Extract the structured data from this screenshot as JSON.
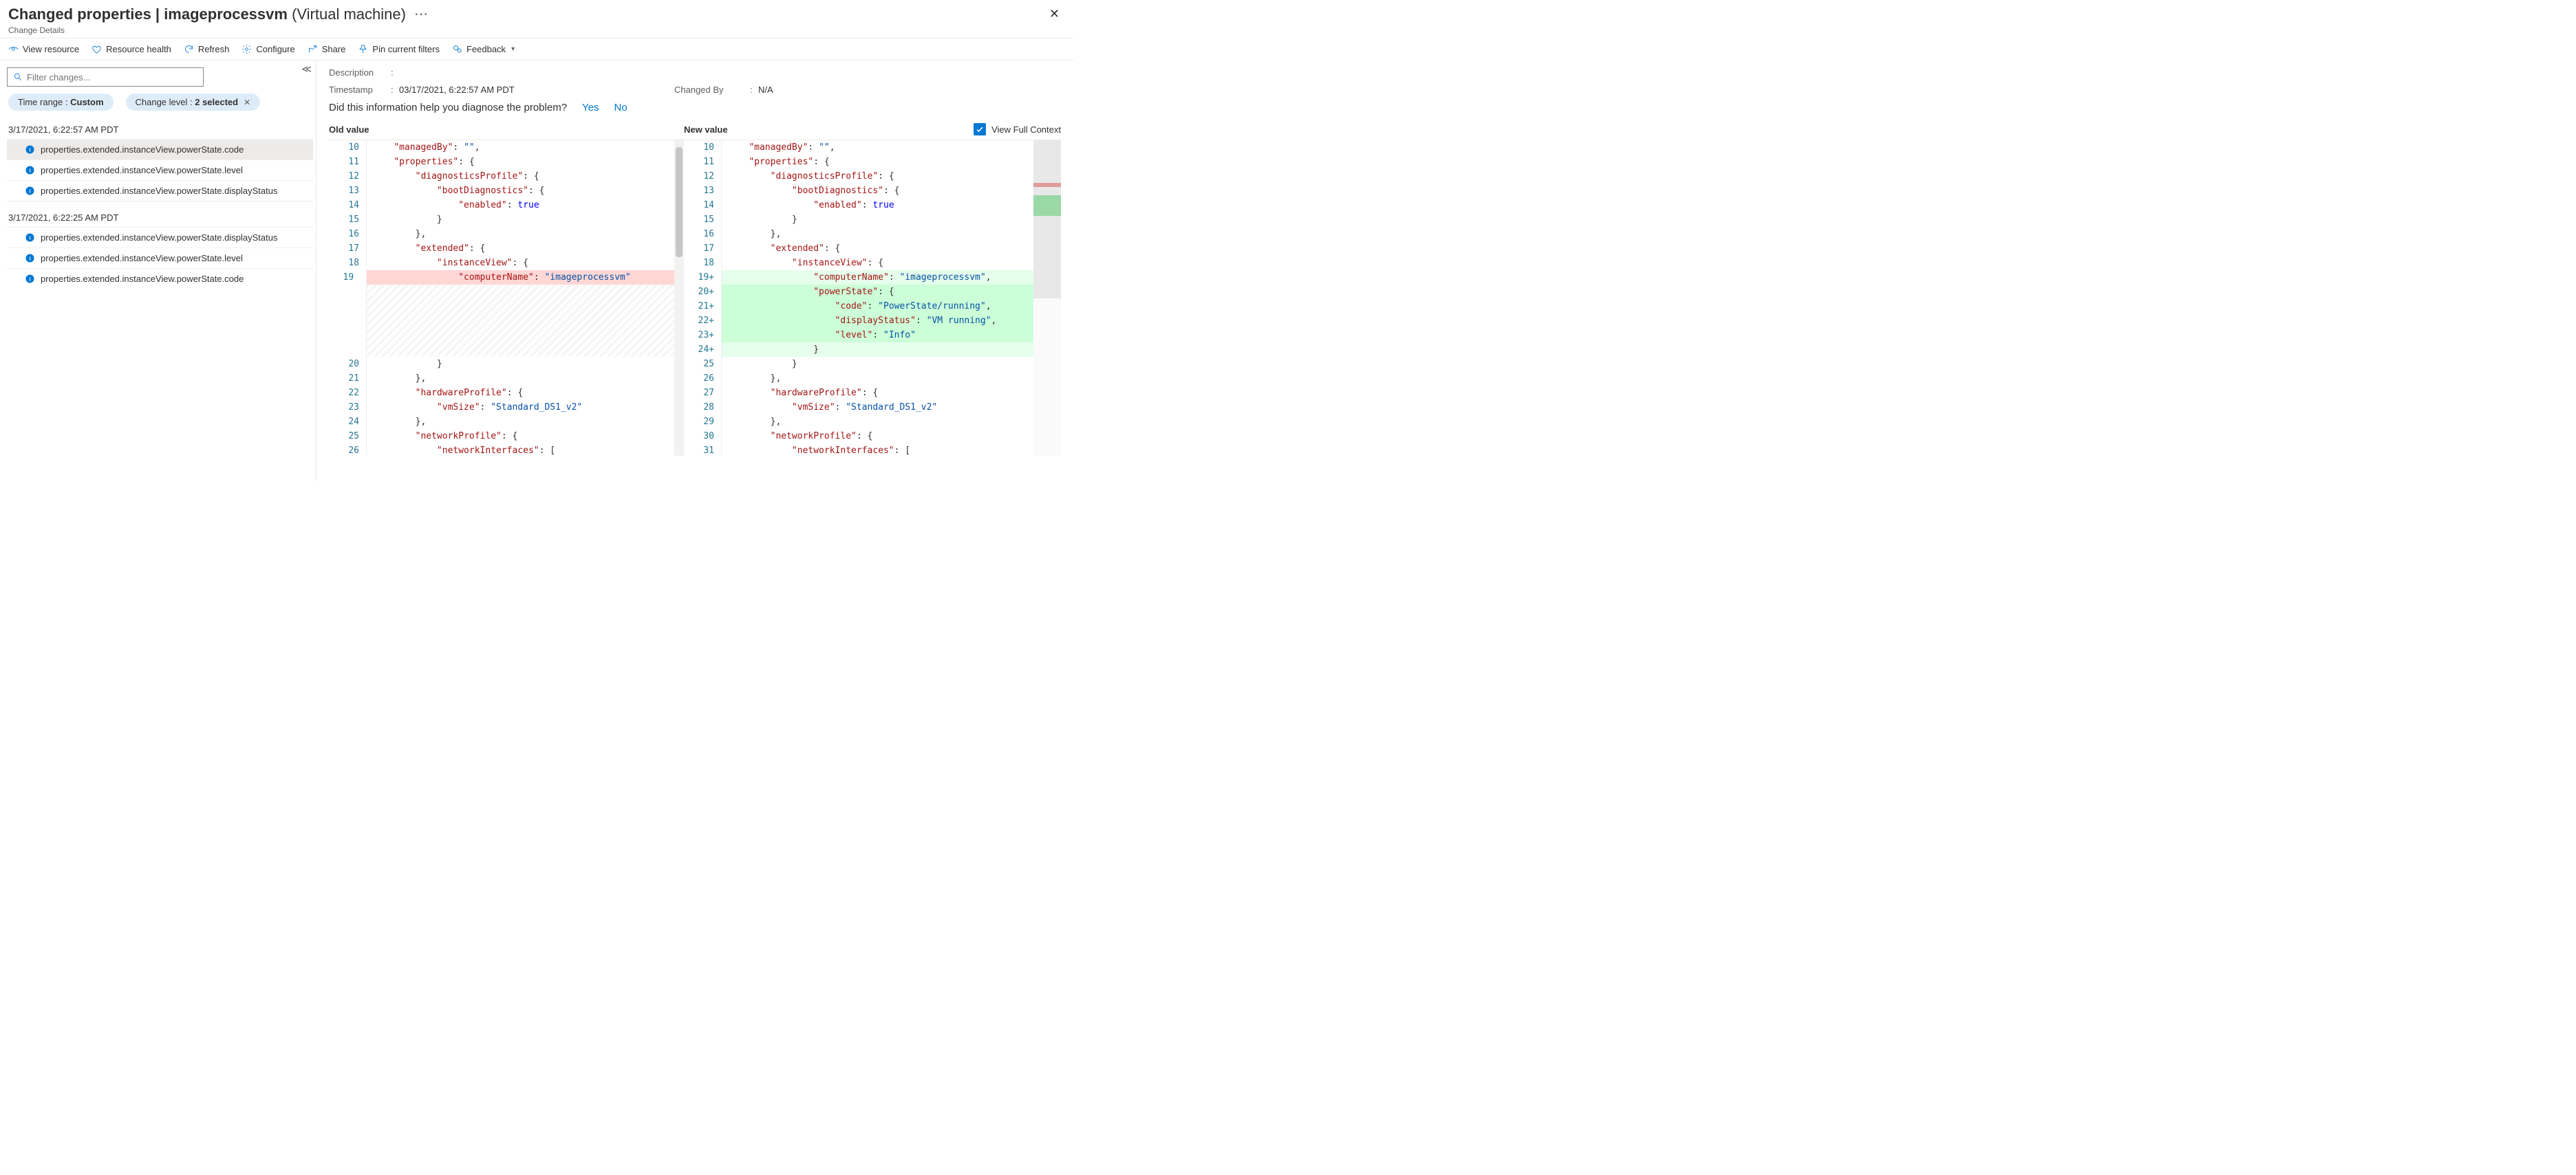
{
  "header": {
    "title_prefix": "Changed properties | ",
    "title_name": "imageprocessvm",
    "title_type": " (Virtual machine)",
    "subtitle": "Change Details"
  },
  "toolbar": {
    "view_resource": "View resource",
    "resource_health": "Resource health",
    "refresh": "Refresh",
    "configure": "Configure",
    "share": "Share",
    "pin": "Pin current filters",
    "feedback": "Feedback"
  },
  "filter": {
    "placeholder": "Filter changes..."
  },
  "pills": {
    "time_label": "Time range : ",
    "time_value": "Custom",
    "level_label": "Change level : ",
    "level_value": "2 selected"
  },
  "groups": [
    {
      "timestamp": "3/17/2021, 6:22:57 AM PDT",
      "rows": [
        {
          "path": "properties.extended.instanceView.powerState.code",
          "selected": true
        },
        {
          "path": "properties.extended.instanceView.powerState.level"
        },
        {
          "path": "properties.extended.instanceView.powerState.displayStatus"
        }
      ]
    },
    {
      "timestamp": "3/17/2021, 6:22:25 AM PDT",
      "rows": [
        {
          "path": "properties.extended.instanceView.powerState.displayStatus"
        },
        {
          "path": "properties.extended.instanceView.powerState.level"
        },
        {
          "path": "properties.extended.instanceView.powerState.code"
        }
      ]
    }
  ],
  "meta": {
    "desc_label": "Description",
    "desc_value": "",
    "ts_label": "Timestamp",
    "ts_value": "03/17/2021, 6:22:57 AM PDT",
    "by_label": "Changed By",
    "by_value": "N/A"
  },
  "diagnose": {
    "q": "Did this information help you diagnose the problem?",
    "yes": "Yes",
    "no": "No"
  },
  "diffhdr": {
    "old": "Old value",
    "new": "New value",
    "ctx": "View Full Context"
  },
  "code": {
    "common_pre": [
      [
        10,
        "    \"managedBy\": \"\","
      ],
      [
        11,
        "    \"properties\": {"
      ],
      [
        12,
        "        \"diagnosticsProfile\": {"
      ],
      [
        13,
        "            \"bootDiagnostics\": {"
      ],
      [
        14,
        "                \"enabled\": true"
      ],
      [
        15,
        "            }"
      ],
      [
        16,
        "        },"
      ],
      [
        17,
        "        \"extended\": {"
      ],
      [
        18,
        "            \"instanceView\": {"
      ]
    ],
    "old_change": [
      [
        19,
        "                \"computerName\": \"imageprocessvm\""
      ]
    ],
    "new_change": [
      [
        19,
        "                \"computerName\": \"imageprocessvm\","
      ],
      [
        20,
        "                \"powerState\": {"
      ],
      [
        21,
        "                    \"code\": \"PowerState/running\","
      ],
      [
        22,
        "                    \"displayStatus\": \"VM running\","
      ],
      [
        23,
        "                    \"level\": \"Info\""
      ],
      [
        24,
        "                }"
      ]
    ],
    "old_post": [
      [
        20,
        "            }"
      ],
      [
        21,
        "        },"
      ],
      [
        22,
        "        \"hardwareProfile\": {"
      ],
      [
        23,
        "            \"vmSize\": \"Standard_DS1_v2\""
      ],
      [
        24,
        "        },"
      ],
      [
        25,
        "        \"networkProfile\": {"
      ],
      [
        26,
        "            \"networkInterfaces\": ["
      ]
    ],
    "new_post": [
      [
        25,
        "            }"
      ],
      [
        26,
        "        },"
      ],
      [
        27,
        "        \"hardwareProfile\": {"
      ],
      [
        28,
        "            \"vmSize\": \"Standard_DS1_v2\""
      ],
      [
        29,
        "        },"
      ],
      [
        30,
        "        \"networkProfile\": {"
      ],
      [
        31,
        "            \"networkInterfaces\": ["
      ]
    ]
  }
}
